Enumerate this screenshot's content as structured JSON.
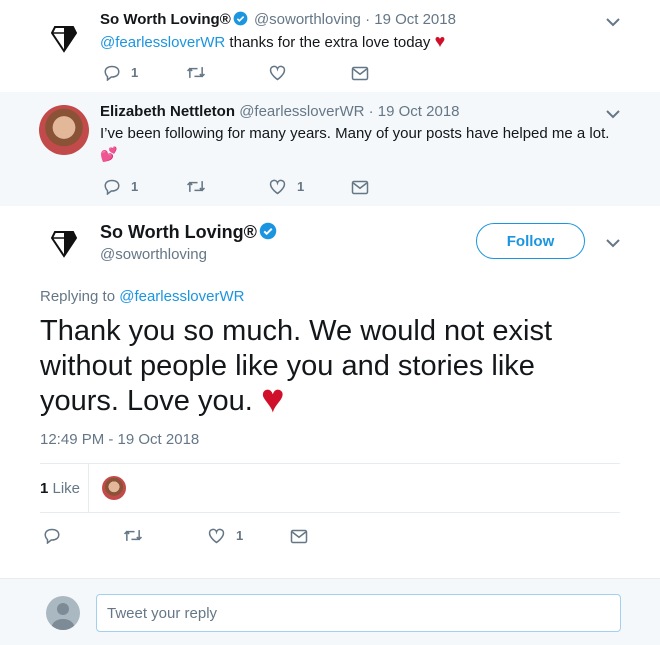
{
  "colors": {
    "accent": "#1b95e0",
    "heart": "#d0102b",
    "muted": "#657786",
    "thread": "#a2d0ef"
  },
  "tweet1": {
    "name": "So Worth Loving®",
    "handle": "@soworthloving",
    "date": "· 19 Oct 2018",
    "mention": "@fearlessloverWR",
    "text": " thanks for the extra love today ",
    "emoji": "♥",
    "reply_count": "1"
  },
  "tweet2": {
    "name": "Elizabeth Nettleton",
    "handle": "@fearlessloverWR",
    "date": "· 19 Oct 2018",
    "text": "I’ve been following for many years. Many of your posts have helped me a lot.",
    "emoji": "💕",
    "reply_count": "1",
    "like_count": "1"
  },
  "main_tweet": {
    "name": "So Worth Loving®",
    "handle": "@soworthloving",
    "follow_label": "Follow",
    "replying_prefix": "Replying to ",
    "replying_to": "@fearlessloverWR",
    "text": "Thank you so much. We would not exist without people like you and stories like yours. Love you.",
    "emoji": "♥",
    "timestamp": "12:49 PM - 19 Oct 2018",
    "likes_number": "1",
    "likes_word": " Like",
    "like_count": "1"
  },
  "reply_box": {
    "placeholder": "Tweet your reply"
  },
  "icons": [
    "logo-diamond-icon",
    "verified-icon",
    "chevron-down-icon",
    "reply-icon",
    "retweet-icon",
    "like-icon",
    "dm-icon",
    "avatar-icon"
  ]
}
